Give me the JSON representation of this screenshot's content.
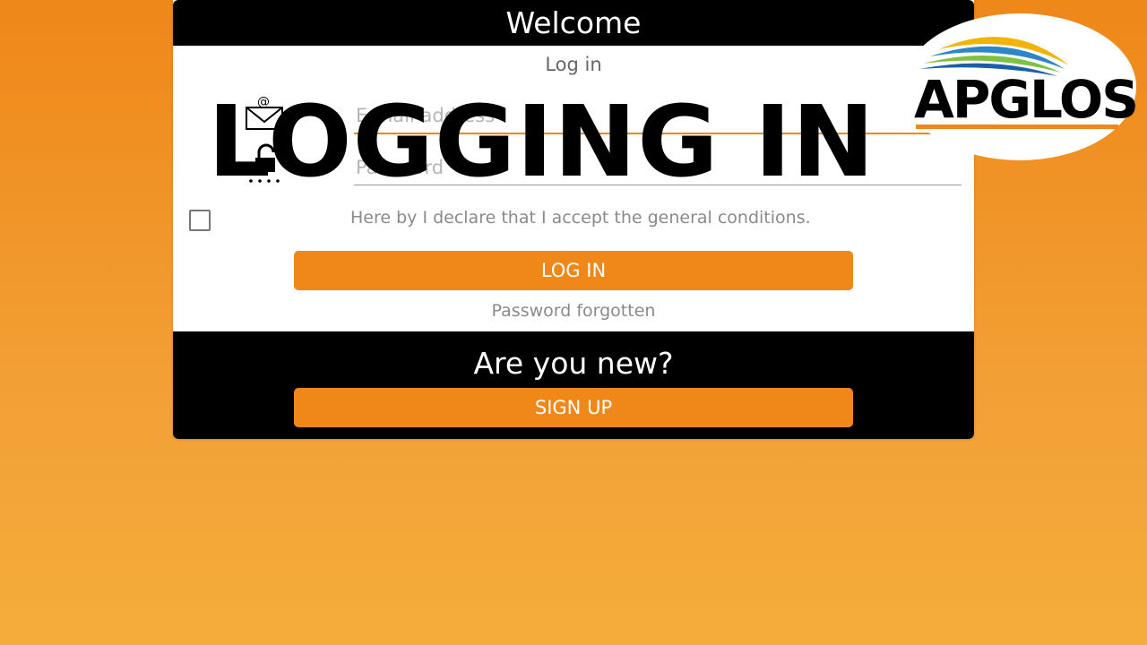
{
  "card": {
    "header_title": "Welcome",
    "subtitle": "Log in",
    "email_placeholder": "E-mail address",
    "password_placeholder": "Password",
    "terms_text": "Here by I declare that I accept the general conditions.",
    "login_button": "LOG IN",
    "forgot_link": "Password forgotten",
    "new_title": "Are you new?",
    "signup_button": "SIGN UP"
  },
  "overlay": {
    "title": "LOGGING IN"
  },
  "logo": {
    "text": "APGLOS"
  },
  "icons": {
    "email": "mail-icon",
    "password": "lock-icon"
  },
  "colors": {
    "accent": "#ef8719",
    "header_bg": "#000000",
    "card_bg": "#ffffff"
  }
}
